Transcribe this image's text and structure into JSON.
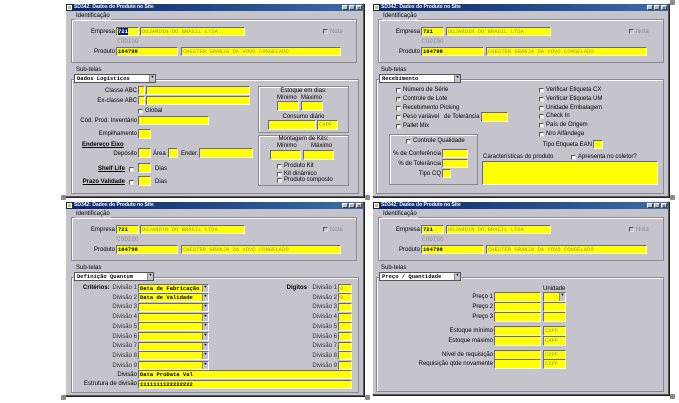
{
  "window_title": "SD342: Dados do Produto no Site",
  "header": {
    "identificacao": "Identificação",
    "empresa_label": "Empresa",
    "empresa_code": "721",
    "empresa_name": "DUJARDIN DO BRASIL LTDA",
    "nota_label": "Nota",
    "codigo_label": "CODIGO",
    "produto_label": "Produto",
    "produto_code": "164798",
    "produto_desc": "CHESTER GRANJA DA VOVO CONGELADO",
    "subtelas_label": "Sub-telas"
  },
  "w1": {
    "subtela": "Dados Logísticos",
    "classe_abc": "Classe ABC",
    "ex_classe_abc": "Ex-classe ABC",
    "global": "Global",
    "cod_prod_inv": "Cód. Prod. Inventário",
    "empilhamento": "Empilhamento",
    "endereco_eixo": "Endereço Eixo",
    "deposito": "Depósito",
    "area": "Área",
    "ender": "Ender.",
    "shelf_life": "Shelf Life",
    "prazo_validade": "Prazo Validade",
    "dias": "Dias",
    "estoque_dias": "Estoque em dias:",
    "minimo": "Mínimo",
    "maximo": "Máximo",
    "consumo": "Consumo diário",
    "consumo_unit": "CXPF",
    "montagem": "Montagem de Kits:",
    "produto_kit": "Produto Kit",
    "kit_dinamico": "Kit dinâmico",
    "produto_composto": "Produto composto"
  },
  "w2": {
    "subtela": "Recebimento",
    "left_checks": [
      {
        "label": "Número de Série",
        "checked": false
      },
      {
        "label": "Controle de Lote",
        "checked": true
      },
      {
        "label": "Recebimento Picking",
        "checked": false
      },
      {
        "label": "Peso variável",
        "checked": false
      },
      {
        "label": "Pallet Mix",
        "checked": false
      }
    ],
    "de_tolerancia": "de Tolerância",
    "right_checks": [
      {
        "label": "Verificar Etiqueta CX",
        "checked": false
      },
      {
        "label": "Verificar Etiqueta UM",
        "checked": false
      },
      {
        "label": "Unidade Embalagem",
        "checked": false
      },
      {
        "label": "Check In",
        "checked": false
      },
      {
        "label": "País de Origem",
        "checked": false
      },
      {
        "label": "Nro Alfândega",
        "checked": false
      }
    ],
    "tipo_etiqueta_ean": "Tipo Etiqueta EAN",
    "controle_qualidade": "Controle Qualidade",
    "pct_conferencia": "% de Conferência",
    "pct_tolerancia": "% de Tolerância",
    "tipo_cq": "Tipo CQ",
    "caracteristicas": "Características do produto",
    "apresenta_coletor": "Apresenta no coletor?"
  },
  "w3": {
    "subtela": "Definição Quantum",
    "criterios": "Critérios:",
    "digitos": "Dígitos",
    "divisoes": [
      {
        "label": "Divisão 1",
        "value": "Data de Fabricação",
        "digits": "0"
      },
      {
        "label": "Divisão 2",
        "value": "Data de Validade",
        "digits": "0"
      },
      {
        "label": "Divisão 3",
        "value": "",
        "digits": ""
      },
      {
        "label": "Divisão 4",
        "value": "",
        "digits": ""
      },
      {
        "label": "Divisão 5",
        "value": "",
        "digits": ""
      },
      {
        "label": "Divisão 6",
        "value": "",
        "digits": ""
      },
      {
        "label": "Divisão 7",
        "value": "",
        "digits": ""
      },
      {
        "label": "Divisão 8",
        "value": "",
        "digits": ""
      },
      {
        "label": "Divisão 9",
        "value": "",
        "digits": ""
      }
    ],
    "divisao_label": "Divisão",
    "divisao_value": "Data ProData Val",
    "estrutura_label": "Estrutura de divisão",
    "estrutura_value": "1111111122222222"
  },
  "w4": {
    "subtela": "Preço / Quantidade",
    "unidade": "Unidade",
    "preco1": "Preço 1",
    "preco2": "Preço 2",
    "preco3": "Preço 3",
    "estoque_minimo": "Estoque mínimo",
    "estoque_maximo": "Estoque máximo",
    "nivel_requisicao": "Nível de requisição",
    "requisicao_novamente": "Requisição qtde novamente",
    "unit": "CXPF"
  }
}
